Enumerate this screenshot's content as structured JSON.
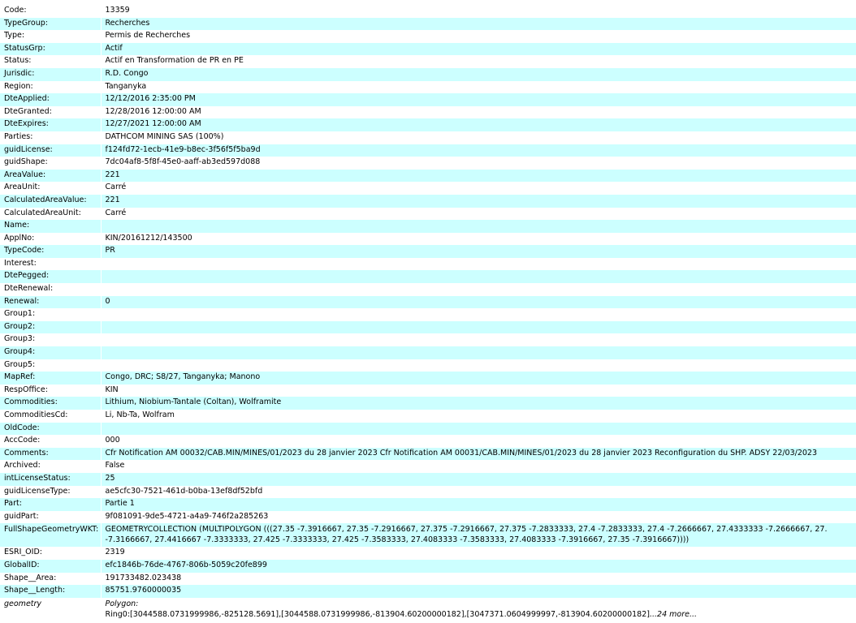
{
  "rows": [
    {
      "key": "Code:",
      "value": "13359"
    },
    {
      "key": "TypeGroup:",
      "value": "Recherches"
    },
    {
      "key": "Type:",
      "value": "Permis de Recherches"
    },
    {
      "key": "StatusGrp:",
      "value": "Actif"
    },
    {
      "key": "Status:",
      "value": "Actif en Transformation de PR en PE"
    },
    {
      "key": "Jurisdic:",
      "value": "R.D. Congo"
    },
    {
      "key": "Region:",
      "value": "Tanganyka"
    },
    {
      "key": "DteApplied:",
      "value": "12/12/2016 2:35:00 PM"
    },
    {
      "key": "DteGranted:",
      "value": "12/28/2016 12:00:00 AM"
    },
    {
      "key": "DteExpires:",
      "value": "12/27/2021 12:00:00 AM"
    },
    {
      "key": "Parties:",
      "value": "DATHCOM MINING SAS (100%)"
    },
    {
      "key": "guidLicense:",
      "value": "f124fd72-1ecb-41e9-b8ec-3f56f5f5ba9d"
    },
    {
      "key": "guidShape:",
      "value": "7dc04af8-5f8f-45e0-aaff-ab3ed597d088"
    },
    {
      "key": "AreaValue:",
      "value": "221"
    },
    {
      "key": "AreaUnit:",
      "value": "Carré"
    },
    {
      "key": "CalculatedAreaValue:",
      "value": "221"
    },
    {
      "key": "CalculatedAreaUnit:",
      "value": "Carré"
    },
    {
      "key": "Name:",
      "value": ""
    },
    {
      "key": "ApplNo:",
      "value": "KIN/20161212/143500"
    },
    {
      "key": "TypeCode:",
      "value": "PR"
    },
    {
      "key": "Interest:",
      "value": ""
    },
    {
      "key": "DtePegged:",
      "value": ""
    },
    {
      "key": "DteRenewal:",
      "value": ""
    },
    {
      "key": "Renewal:",
      "value": "0"
    },
    {
      "key": "Group1:",
      "value": ""
    },
    {
      "key": "Group2:",
      "value": ""
    },
    {
      "key": "Group3:",
      "value": ""
    },
    {
      "key": "Group4:",
      "value": ""
    },
    {
      "key": "Group5:",
      "value": ""
    },
    {
      "key": "MapRef:",
      "value": "Congo, DRC; S8/27, Tanganyka; Manono"
    },
    {
      "key": "RespOffice:",
      "value": "KIN"
    },
    {
      "key": "Commodities:",
      "value": "Lithium, Niobium-Tantale (Coltan), Wolframite"
    },
    {
      "key": "CommoditiesCd:",
      "value": "Li, Nb-Ta, Wolfram"
    },
    {
      "key": "OldCode:",
      "value": ""
    },
    {
      "key": "AccCode:",
      "value": "000"
    },
    {
      "key": "Comments:",
      "value": "Cfr Notification AM 00032/CAB.MIN/MINES/01/2023 du 28 janvier 2023 Cfr Notification AM 00031/CAB.MIN/MINES/01/2023 du 28 janvier 2023 Reconfiguration du SHP. ADSY 22/03/2023"
    },
    {
      "key": "Archived:",
      "value": "False"
    },
    {
      "key": "intLicenseStatus:",
      "value": "25"
    },
    {
      "key": "guidLicenseType:",
      "value": "ae5cfc30-7521-461d-b0ba-13ef8df52bfd"
    },
    {
      "key": "Part:",
      "value": "Partie 1"
    },
    {
      "key": "guidPart:",
      "value": "9f081091-9de5-4721-a4a9-746f2a285263"
    }
  ],
  "wkt": {
    "key": "FullShapeGeometryWKT:",
    "line1": "GEOMETRYCOLLECTION (MULTIPOLYGON (((27.35 -7.3916667, 27.35 -7.2916667, 27.375 -7.2916667, 27.375 -7.2833333, 27.4 -7.2833333, 27.4 -7.2666667, 27.4333333 -7.2666667, 27.",
    "line2": "-7.3166667, 27.4416667 -7.3333333, 27.425 -7.3333333, 27.425 -7.3583333, 27.4083333 -7.3583333, 27.4083333 -7.3916667, 27.35 -7.3916667))))"
  },
  "rows_after": [
    {
      "key": "ESRI_OID:",
      "value": "2319"
    },
    {
      "key": "GlobalID:",
      "value": "efc1846b-76de-4767-806b-5059c20fe899"
    },
    {
      "key": "Shape__Area:",
      "value": "191733482.023438"
    },
    {
      "key": "Shape__Length:",
      "value": "85751.9760000035"
    }
  ],
  "geometry": {
    "key": "geometry",
    "type": "Polygon:",
    "ring": "Ring0:[3044588.0731999986,-825128.5691],[3044588.0731999986,-813904.60200000182],[3047371.0604999997,-813904.60200000182]",
    "more": "...24 more..."
  }
}
